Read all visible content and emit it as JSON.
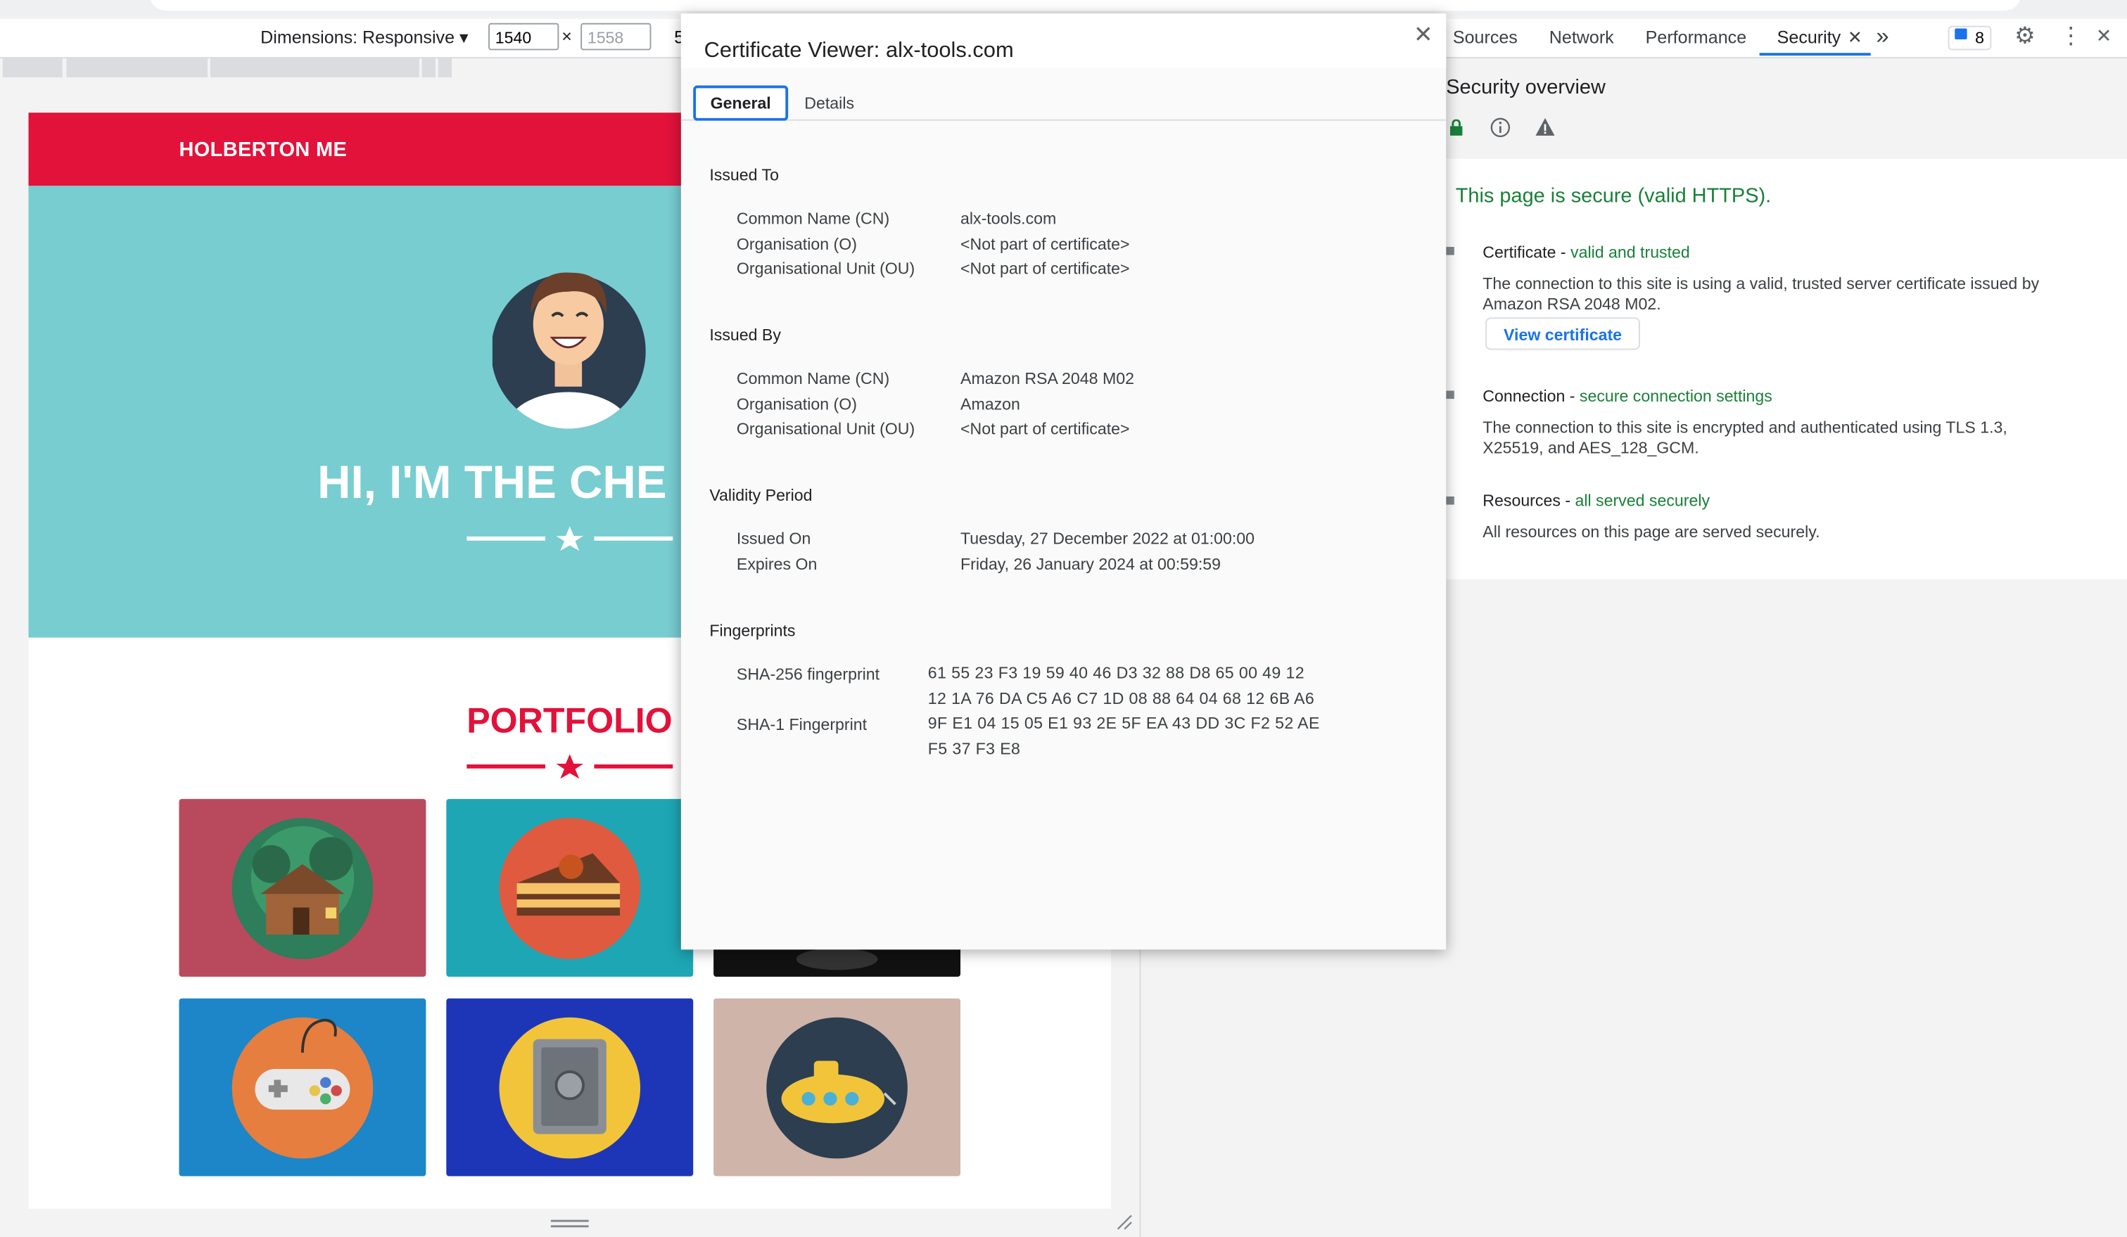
{
  "device_toolbar": {
    "dimensions_label": "Dimensions: Responsive ▾",
    "width_value": "1540",
    "times": "×",
    "height_value": "1558",
    "more": "5"
  },
  "site": {
    "title": "HOLBERTON ME",
    "hero_title": "HI, I'M THE CHE",
    "portfolio_title": "PORTFOLIO",
    "tiles": [
      {
        "name": "cabin",
        "bg": "#b94a5d"
      },
      {
        "name": "cake",
        "bg": "#1ea6b4"
      },
      {
        "name": "circus",
        "bg": "#111111"
      },
      {
        "name": "game-controller",
        "bg": "#1c86c8"
      },
      {
        "name": "safe",
        "bg": "#1d36b8"
      },
      {
        "name": "submarine",
        "bg": "#cfb4a9"
      }
    ]
  },
  "devtools": {
    "tabs": [
      "Sources",
      "Network",
      "Performance",
      "Security"
    ],
    "active_tab": "Security",
    "more_tabs": "»",
    "issues_count": "8",
    "overview_title": "Security overview",
    "secure_message": "This page is secure (valid HTTPS).",
    "certificate": {
      "label": "Certificate - ",
      "status": "valid and trusted",
      "description": "The connection to this site is using a valid, trusted server certificate issued by Amazon RSA 2048 M02.",
      "button": "View certificate"
    },
    "connection": {
      "label": "Connection - ",
      "status": "secure connection settings",
      "description": "The connection to this site is encrypted and authenticated using TLS 1.3, X25519, and AES_128_GCM."
    },
    "resources": {
      "label": "Resources - ",
      "status": "all served securely",
      "description": "All resources on this page are served securely."
    }
  },
  "cert_viewer": {
    "title": "Certificate Viewer: alx-tools.com",
    "close": "✕",
    "tabs": {
      "general": "General",
      "details": "Details"
    },
    "issued_to": {
      "heading": "Issued To",
      "rows": [
        {
          "k": "Common Name (CN)",
          "v": "alx-tools.com"
        },
        {
          "k": "Organisation (O)",
          "v": "<Not part of certificate>"
        },
        {
          "k": "Organisational Unit (OU)",
          "v": "<Not part of certificate>"
        }
      ]
    },
    "issued_by": {
      "heading": "Issued By",
      "rows": [
        {
          "k": "Common Name (CN)",
          "v": "Amazon RSA 2048 M02"
        },
        {
          "k": "Organisation (O)",
          "v": "Amazon"
        },
        {
          "k": "Organisational Unit (OU)",
          "v": "<Not part of certificate>"
        }
      ]
    },
    "validity": {
      "heading": "Validity Period",
      "rows": [
        {
          "k": "Issued On",
          "v": "Tuesday, 27 December 2022 at 01:00:00"
        },
        {
          "k": "Expires On",
          "v": "Friday, 26 January 2024 at 00:59:59"
        }
      ]
    },
    "fingerprints": {
      "heading": "Fingerprints",
      "sha256_label": "SHA-256 fingerprint",
      "sha256_line1": "61 55 23 F3 19 59 40 46 D3 32 88 D8 65 00 49 12",
      "sha256_line2": "12 1A 76 DA C5 A6 C7 1D 08 88 64 04 68 12 6B A6",
      "sha1_label": "SHA-1 Fingerprint",
      "sha1_line1": "9F E1 04 15 05 E1 93 2E 5F EA 43 DD 3C F2 52 AE",
      "sha1_line2": "F5 37 F3 E8"
    }
  }
}
